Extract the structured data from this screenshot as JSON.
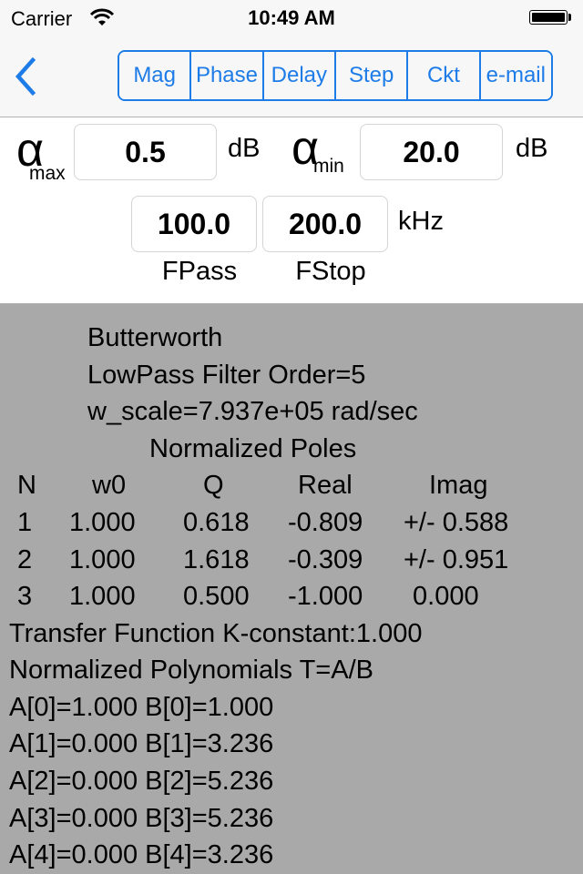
{
  "status_bar": {
    "carrier": "Carrier",
    "wifi_icon": "wifi-icon",
    "time": "10:49 AM",
    "battery_icon": "battery-icon",
    "battery_level_percent": 100
  },
  "nav": {
    "back_icon": "chevron-left-icon",
    "segments": [
      {
        "label": "Mag"
      },
      {
        "label": "Phase"
      },
      {
        "label": "Delay"
      },
      {
        "label": "Step"
      },
      {
        "label": "Ckt"
      },
      {
        "label": "e-mail"
      }
    ],
    "accent_color": "#1e7ce8"
  },
  "inputs": {
    "alpha_symbol": "α",
    "alpha_max_sub": "max",
    "alpha_max_value": "0.5",
    "alpha_max_unit": "dB",
    "alpha_min_sub": "min",
    "alpha_min_value": "20.0",
    "alpha_min_unit": "dB",
    "fpass_value": "100.0",
    "fstop_value": "200.0",
    "freq_unit": "kHz",
    "fpass_label": "FPass",
    "fstop_label": "FStop"
  },
  "results": {
    "filter_type": "Butterworth",
    "filter_order": "LowPass Filter Order=5",
    "w_scale": "w_scale=7.937e+05 rad/sec",
    "poles_title": "Normalized Poles",
    "pole_headers": [
      "N",
      "w0",
      "Q",
      "Real",
      "Imag"
    ],
    "poles": [
      [
        "1",
        "1.000",
        "0.618",
        "-0.809",
        "+/- 0.588"
      ],
      [
        "2",
        "1.000",
        "1.618",
        "-0.309",
        "+/- 0.951"
      ],
      [
        "3",
        "1.000",
        "0.500",
        "-1.000",
        " 0.000"
      ]
    ],
    "k_constant": "Transfer Function K-constant:1.000",
    "poly_title": "Normalized Polynomials T=A/B",
    "polynomials": [
      "A[0]=1.000 B[0]=1.000",
      "A[1]=0.000 B[1]=3.236",
      "A[2]=0.000 B[2]=5.236",
      "A[3]=0.000 B[3]=5.236",
      "A[4]=0.000 B[4]=3.236"
    ],
    "background_color": "#a9a9a9"
  }
}
